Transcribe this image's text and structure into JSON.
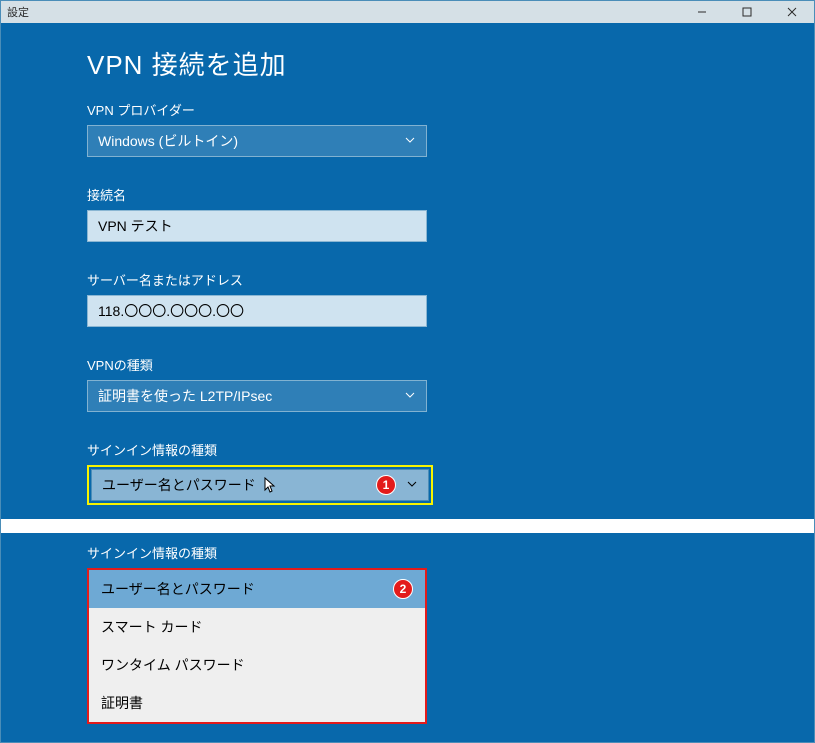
{
  "titlebar": {
    "label": "設定"
  },
  "page": {
    "title": "VPN 接続を追加",
    "provider_label": "VPN プロバイダー",
    "provider_value": "Windows (ビルトイン)",
    "conn_name_label": "接続名",
    "conn_name_value": "VPN テスト",
    "server_label": "サーバー名またはアドレス",
    "server_value": "118.〇〇〇.〇〇〇.〇〇",
    "vpntype_label": "VPNの種類",
    "vpntype_value": "証明書を使った L2TP/IPsec",
    "signin_label": "サインイン情報の種類",
    "signin_value": "ユーザー名とパスワード",
    "signin_label2": "サインイン情報の種類"
  },
  "badges": {
    "one": "1",
    "two": "2"
  },
  "dropdown": {
    "items": [
      "ユーザー名とパスワード",
      "スマート カード",
      "ワンタイム パスワード",
      "証明書"
    ]
  }
}
